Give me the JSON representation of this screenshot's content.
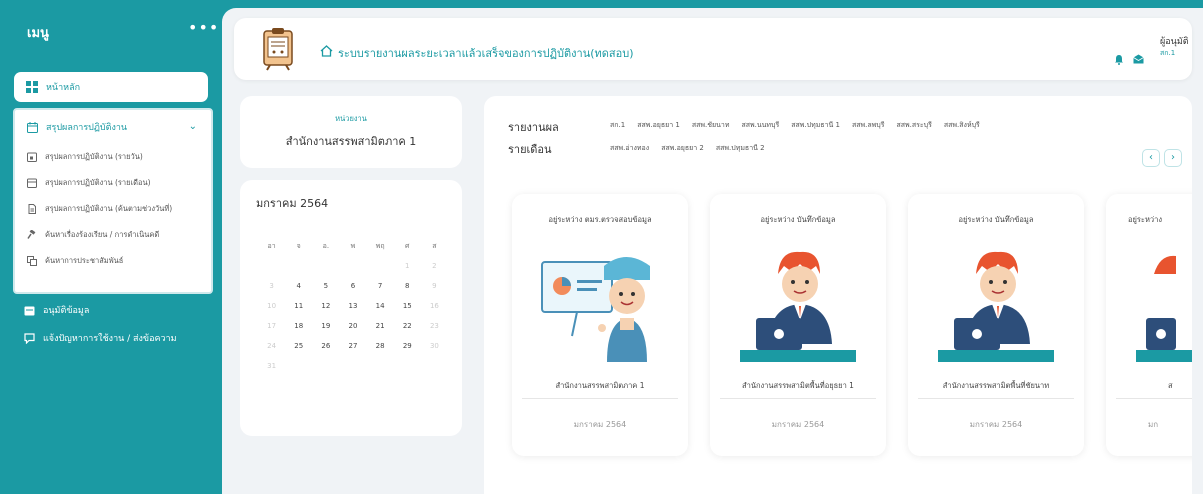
{
  "sidebar": {
    "title": "เมนู",
    "more": "•••",
    "home_label": "หน้าหลัก",
    "group": {
      "label": "สรุปผลการปฏิบัติงาน",
      "items": [
        {
          "label": "สรุปผลการปฏิบัติงาน (รายวัน)"
        },
        {
          "label": "สรุปผลการปฏิบัติงาน (รายเดือน)"
        },
        {
          "label": "สรุปผลการปฏิบัติงาน (ค้นตามช่วงวันที่)"
        },
        {
          "label": "ค้นหาเรื่องร้องเรียน / การดำเนินคดี"
        },
        {
          "label": "ค้นหาการประชาสัมพันธ์"
        }
      ]
    },
    "approve_label": "อนุมัติข้อมูล",
    "report_issue_label": "แจ้งปัญหาการใช้งาน / ส่งข้อความ"
  },
  "header": {
    "title": "ระบบรายงานผลระยะเวลาแล้วเสร็จของการปฏิบัติงาน(ทดสอบ)",
    "user_role": "ผู้อนุมัติ",
    "user_sub": "สก.1"
  },
  "unit": {
    "label": "หน่วยงาน",
    "value": "สำนักงานสรรพสามิตภาค 1"
  },
  "calendar": {
    "title": "มกราคม 2564",
    "weekdays": [
      "อา",
      "จ",
      "อ.",
      "พ",
      "พฤ",
      "ศ",
      "ส"
    ],
    "days": [
      {
        "d": "",
        "dim": false
      },
      {
        "d": "",
        "dim": false
      },
      {
        "d": "",
        "dim": false
      },
      {
        "d": "",
        "dim": false
      },
      {
        "d": "",
        "dim": false
      },
      {
        "d": "1",
        "dim": true
      },
      {
        "d": "2",
        "dim": true
      },
      {
        "d": "3",
        "dim": true
      },
      {
        "d": "4",
        "dim": false
      },
      {
        "d": "5",
        "dim": false
      },
      {
        "d": "6",
        "dim": false
      },
      {
        "d": "7",
        "dim": false
      },
      {
        "d": "8",
        "dim": false
      },
      {
        "d": "9",
        "dim": true
      },
      {
        "d": "10",
        "dim": true
      },
      {
        "d": "11",
        "dim": false
      },
      {
        "d": "12",
        "dim": false
      },
      {
        "d": "13",
        "dim": false
      },
      {
        "d": "14",
        "dim": false
      },
      {
        "d": "15",
        "dim": false
      },
      {
        "d": "16",
        "dim": true
      },
      {
        "d": "17",
        "dim": true
      },
      {
        "d": "18",
        "dim": false
      },
      {
        "d": "19",
        "dim": false
      },
      {
        "d": "20",
        "dim": false
      },
      {
        "d": "21",
        "dim": false
      },
      {
        "d": "22",
        "dim": false
      },
      {
        "d": "23",
        "dim": true
      },
      {
        "d": "24",
        "dim": true
      },
      {
        "d": "25",
        "dim": false
      },
      {
        "d": "26",
        "dim": false
      },
      {
        "d": "27",
        "dim": false
      },
      {
        "d": "28",
        "dim": false
      },
      {
        "d": "29",
        "dim": false
      },
      {
        "d": "30",
        "dim": true
      },
      {
        "d": "31",
        "dim": true
      }
    ]
  },
  "report": {
    "label_result": "รายงานผล",
    "label_monthly": "รายเดือน",
    "tabs_row1": [
      "สก.1",
      "สสพ.อยุธยา 1",
      "สสพ.ชัยนาท",
      "สสพ.นนทบุรี",
      "สสพ.ปทุมธานี 1",
      "สสพ.ลพบุรี",
      "สสพ.สระบุรี",
      "สสพ.สิงห์บุรี"
    ],
    "tabs_row2": [
      "สสพ.อ่างทอง",
      "สสพ.อยุธยา 2",
      "สสพ.ปทุมธานี 2"
    ],
    "prev": "‹",
    "next": "›",
    "cards": [
      {
        "status": "อยู่ระหว่าง ตมร.ตรวจสอบข้อมูล",
        "org": "สำนักงานสรรพสามิตภาค 1",
        "month": "มกราคม 2564",
        "image": "presenter-illustration"
      },
      {
        "status": "อยู่ระหว่าง บันทึกข้อมูล",
        "org": "สำนักงานสรรพสามิตพื้นที่อยุธยา 1",
        "month": "มกราคม 2564",
        "image": "laptop-worker-illustration"
      },
      {
        "status": "อยู่ระหว่าง บันทึกข้อมูล",
        "org": "สำนักงานสรรพสามิตพื้นที่ชัยนาท",
        "month": "มกราคม 2564",
        "image": "laptop-worker-illustration"
      },
      {
        "status": "อยู่ระหว่าง",
        "org": "ส",
        "month": "มก",
        "image": "laptop-worker-illustration"
      }
    ]
  },
  "colors": {
    "teal": "#1b9aa3",
    "background": "#f0f3f6"
  }
}
